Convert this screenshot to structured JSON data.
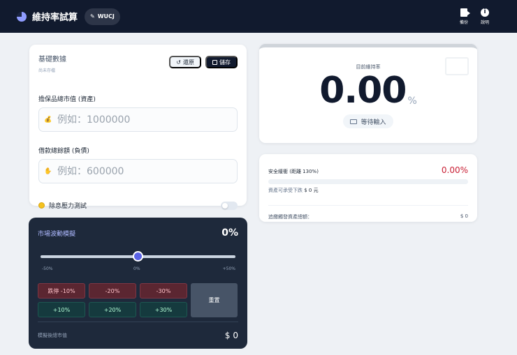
{
  "header": {
    "title": "維持率試算",
    "user_label": "WUCJ",
    "actions": [
      {
        "label": "備份",
        "icon": "export-icon"
      },
      {
        "label": "說明",
        "icon": "info-icon"
      }
    ]
  },
  "base_card": {
    "title": "基礎數據",
    "subtitle": "尚未存檔",
    "restore_label": "還原",
    "save_label": "儲存",
    "collateral_label": "擔保品總市值 (資產)",
    "collateral_placeholder": "例如：1000000",
    "collateral_value": "",
    "loan_label": "借款總餘額 (負債)",
    "loan_placeholder": "例如：600000",
    "loan_value": "",
    "stress_label": "除息壓力測試",
    "stress_enabled": false
  },
  "market_card": {
    "title": "市場波動模擬",
    "current_pct": "0%",
    "slider": {
      "min": -50,
      "max": 50,
      "value": 0
    },
    "slider_labels": [
      "-50%",
      "0%",
      "+50%"
    ],
    "neg_buttons": [
      "跌停 -10%",
      "-20%",
      "-30%"
    ],
    "pos_buttons": [
      "+10%",
      "+20%",
      "+30%"
    ],
    "reset_label": "重置",
    "result_label": "模擬後總市值",
    "result_value": "$ 0"
  },
  "ratio_card": {
    "label": "目前維持率",
    "value": "0.00",
    "unit": "%",
    "status": "等待輸入"
  },
  "safety_card": {
    "label": "安全緩衝 (距離 130%)",
    "value": "0.00%",
    "progress": 0,
    "sub_label": "資產可承受下跌",
    "sub_value": "$ 0 元",
    "trigger_label": "追繳觸發資產總額：",
    "trigger_value": "$ 0"
  },
  "colors": {
    "header_bg": "#111a2e",
    "accent": "#5b63e6",
    "danger": "#c81e33",
    "market_bg": "#1e293b"
  }
}
